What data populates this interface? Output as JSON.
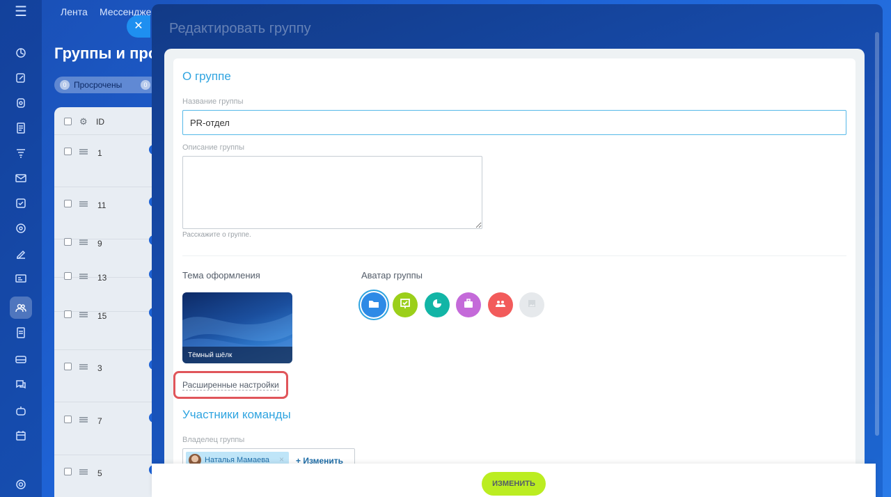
{
  "top_nav": {
    "items": [
      "Лента",
      "Мессенджер"
    ]
  },
  "background_page": {
    "title": "Группы и про",
    "filter": {
      "count1": "0",
      "label": "Просрочены",
      "count2": "0"
    },
    "table": {
      "id_header": "ID",
      "ids": [
        "1",
        "11",
        "9",
        "13",
        "15",
        "3",
        "7",
        "5"
      ]
    }
  },
  "slider": {
    "title": "Редактировать группу",
    "about": {
      "heading": "О группе",
      "name_label": "Название группы",
      "name_value": "PR-отдел",
      "desc_label": "Описание группы",
      "desc_value": "",
      "desc_hint": "Расскажите о группе."
    },
    "theme": {
      "label": "Тема оформления",
      "name": "Тёмный шёлк"
    },
    "avatar": {
      "label": "Аватар группы",
      "options": [
        {
          "icon": "folder-icon",
          "color": "#2d8ae6",
          "selected": true
        },
        {
          "icon": "chart-board-icon",
          "color": "#9bcf1a"
        },
        {
          "icon": "pie-chart-icon",
          "color": "#12b5a6"
        },
        {
          "icon": "briefcase-icon",
          "color": "#c46ad9"
        },
        {
          "icon": "people-icon",
          "color": "#f25b5b"
        },
        {
          "icon": "image-icon",
          "color": "#e6e9ec"
        }
      ]
    },
    "advanced_link": "Расширенные настройки",
    "team": {
      "heading": "Участники команды",
      "owner_label": "Владелец группы",
      "owner_name": "Наталья Мамаева",
      "change_label": "+ Изменить"
    }
  },
  "footer": {
    "save_label": "ИЗМЕНИТЬ"
  },
  "colors": {
    "accent": "#2fa4e0",
    "save": "#bbed21",
    "highlight": "#e0555a"
  }
}
